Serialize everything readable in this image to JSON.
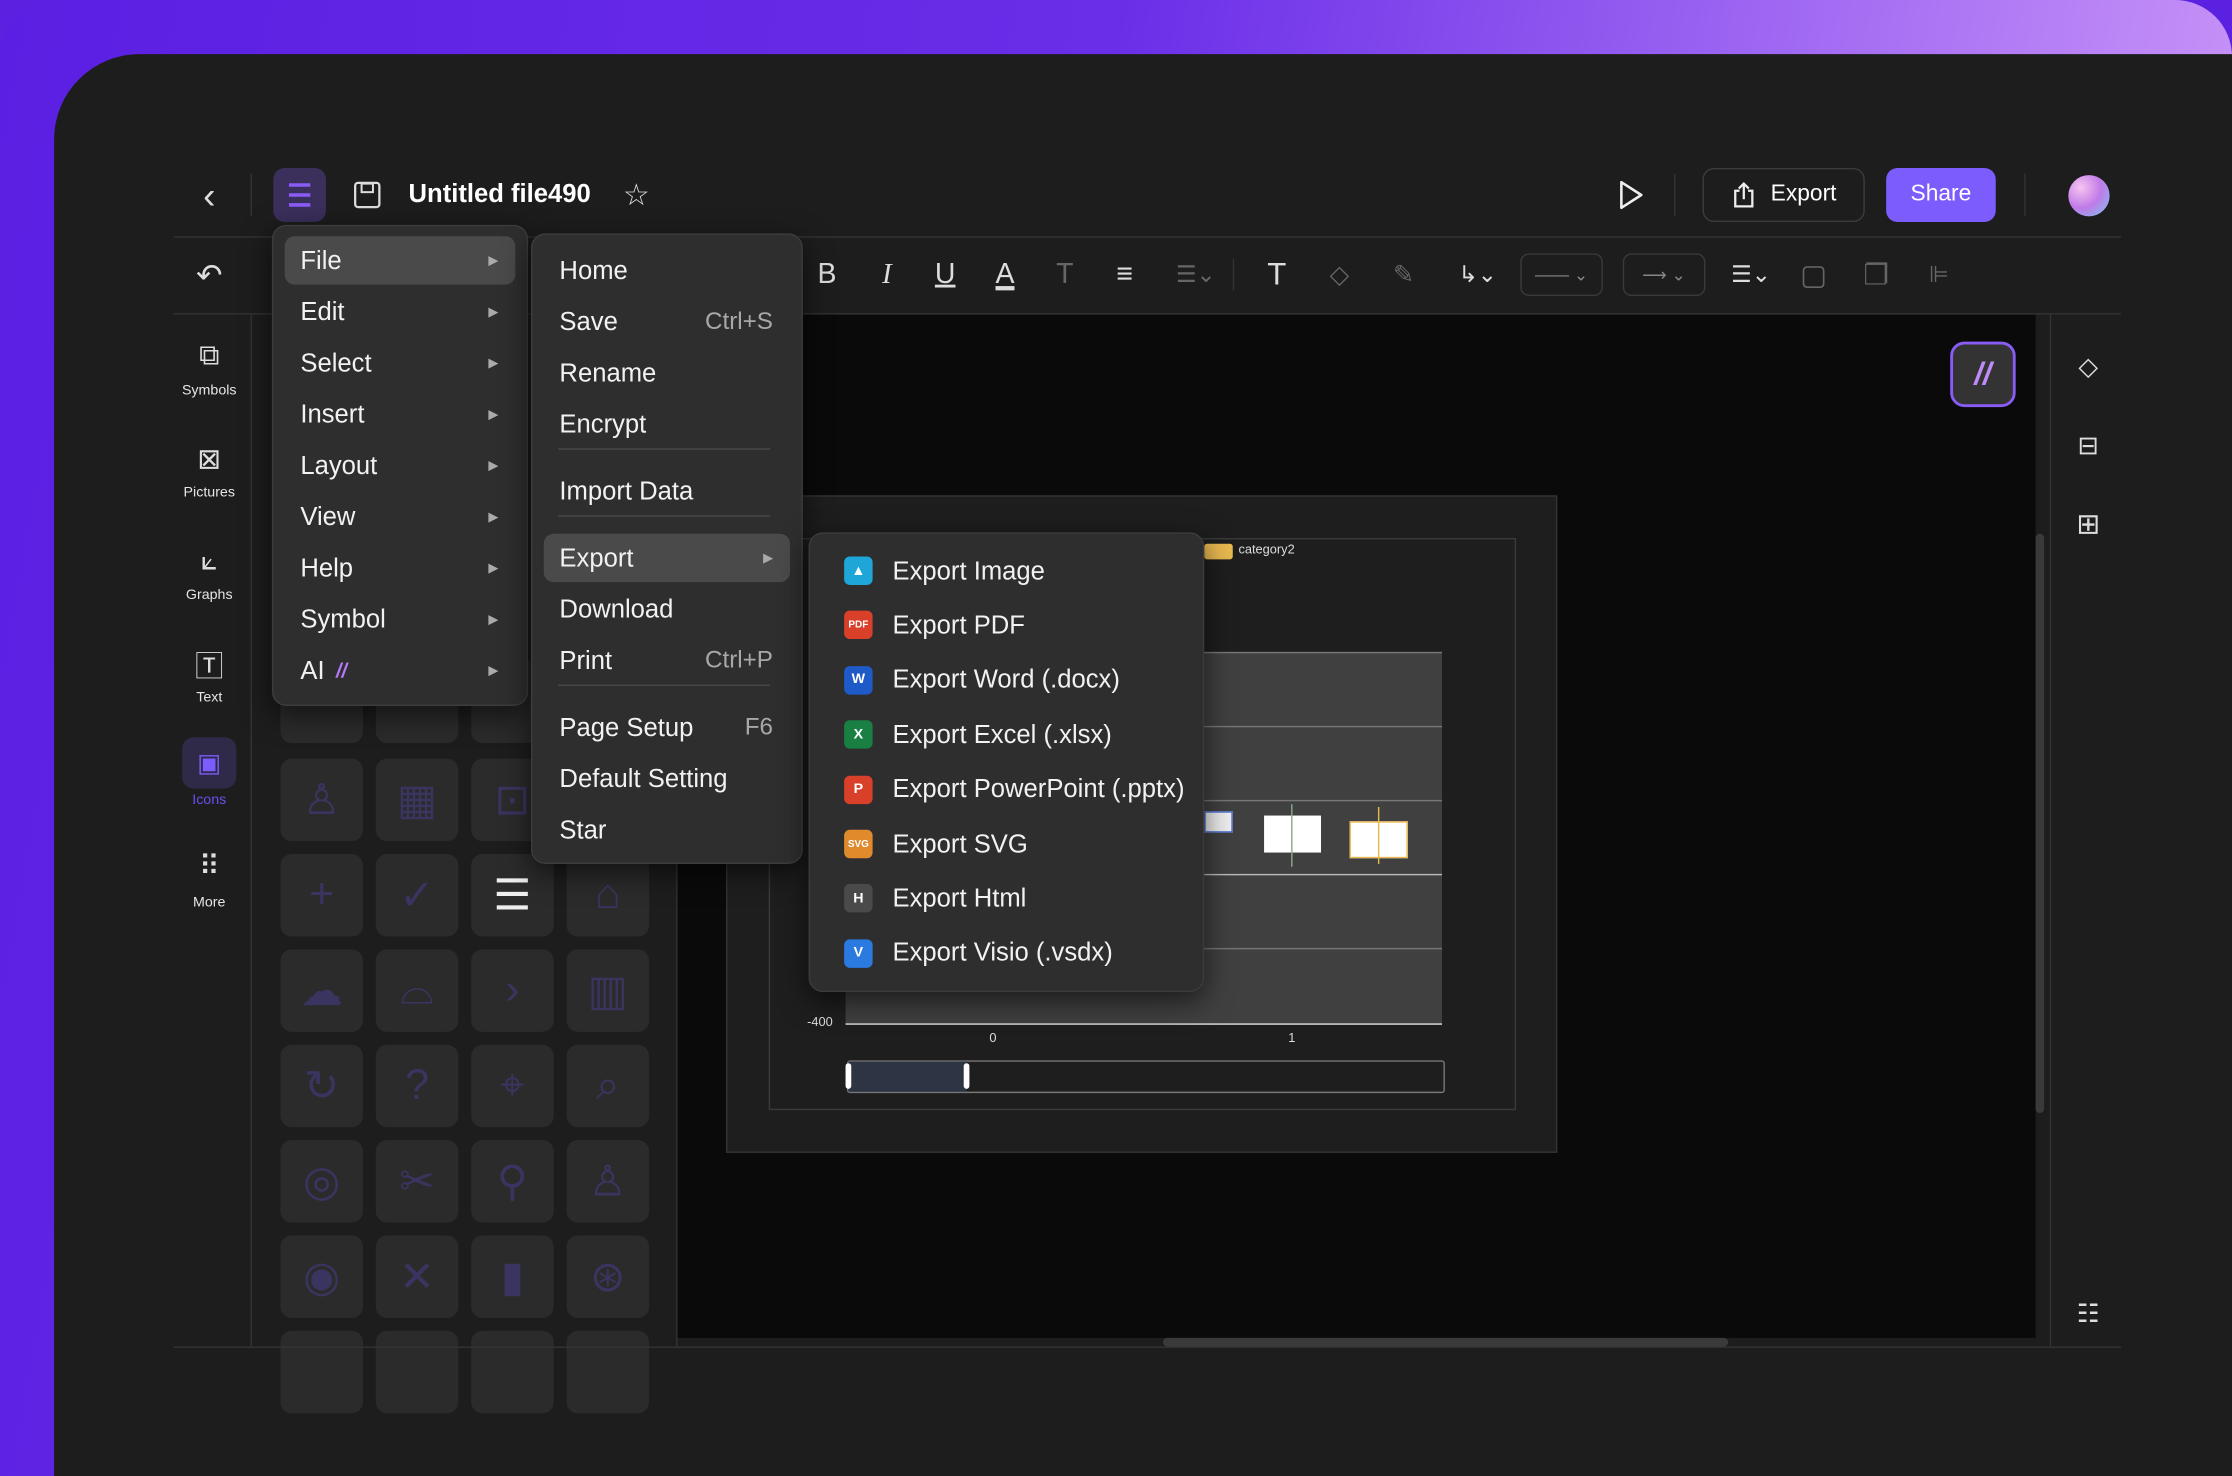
{
  "header": {
    "title": "Untitled file490",
    "export_label": "Export",
    "share_label": "Share"
  },
  "sidebar": {
    "items": [
      {
        "label": "Symbols",
        "icon": "symbols-icon"
      },
      {
        "label": "Pictures",
        "icon": "pictures-icon"
      },
      {
        "label": "Graphs",
        "icon": "graphs-icon"
      },
      {
        "label": "Text",
        "icon": "text-icon"
      },
      {
        "label": "Icons",
        "icon": "icons-icon",
        "active": true
      },
      {
        "label": "More",
        "icon": "more-icon"
      }
    ]
  },
  "main_menu": {
    "items": [
      {
        "label": "File",
        "active": true
      },
      {
        "label": "Edit"
      },
      {
        "label": "Select"
      },
      {
        "label": "Insert"
      },
      {
        "label": "Layout"
      },
      {
        "label": "View"
      },
      {
        "label": "Help"
      },
      {
        "label": "Symbol"
      },
      {
        "label": "AI"
      }
    ]
  },
  "file_menu": {
    "items": [
      {
        "label": "Home"
      },
      {
        "label": "Save",
        "shortcut": "Ctrl+S"
      },
      {
        "label": "Rename"
      },
      {
        "label": "Encrypt"
      },
      {
        "label": "Import Data"
      },
      {
        "label": "Export",
        "active": true
      },
      {
        "label": "Download"
      },
      {
        "label": "Print",
        "shortcut": "Ctrl+P"
      },
      {
        "label": "Page Setup",
        "shortcut": "F6"
      },
      {
        "label": "Default Setting"
      },
      {
        "label": "Star"
      }
    ]
  },
  "export_menu": {
    "items": [
      {
        "label": "Export Image",
        "badge": "",
        "color": "#1fa6d8"
      },
      {
        "label": "Export PDF",
        "badge": "PDF",
        "color": "#d8402a"
      },
      {
        "label": "Export Word (.docx)",
        "badge": "W",
        "color": "#1f5bc8"
      },
      {
        "label": "Export Excel (.xlsx)",
        "badge": "X",
        "color": "#1a7f43"
      },
      {
        "label": "Export PowerPoint (.pptx)",
        "badge": "P",
        "color": "#d8402a"
      },
      {
        "label": "Export SVG",
        "badge": "SVG",
        "color": "#e08a2c"
      },
      {
        "label": "Export Html",
        "badge": "H",
        "color": "#4a4a4a"
      },
      {
        "label": "Export Visio (.vsdx)",
        "badge": "V",
        "color": "#2a7ae0"
      }
    ]
  },
  "canvas_chart": {
    "legend": "category2",
    "legend_color": "#e8b850",
    "y_tick": "-400",
    "x_ticks": [
      "0",
      "1"
    ]
  },
  "colors": {
    "accent": "#7c5cfc",
    "menu_bg": "#2e2e2e",
    "panel_bg": "#1d1d1d",
    "canvas_bg": "#0a0a0a"
  }
}
